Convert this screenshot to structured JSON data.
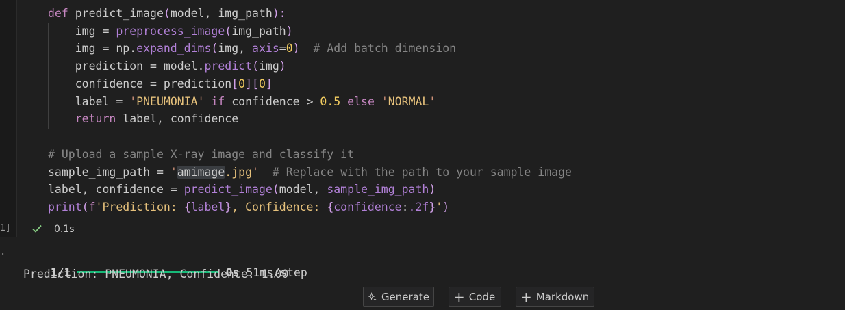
{
  "code_cell": {
    "lines": [
      {
        "parts": [
          [
            "kw",
            "def "
          ],
          [
            "var",
            "predict_image"
          ],
          [
            "brk",
            "("
          ],
          [
            "var",
            "model, img_path"
          ],
          [
            "brk",
            "):"
          ]
        ]
      },
      {
        "parts": [
          [
            "var",
            "    img = "
          ],
          [
            "fn",
            "preprocess_image"
          ],
          [
            "brk",
            "("
          ],
          [
            "var",
            "img_path"
          ],
          [
            "brk",
            ")"
          ]
        ]
      },
      {
        "parts": [
          [
            "var",
            "    img = np."
          ],
          [
            "fn",
            "expand_dims"
          ],
          [
            "brk",
            "("
          ],
          [
            "var",
            "img, "
          ],
          [
            "fn",
            "axis"
          ],
          [
            "var",
            "="
          ],
          [
            "num",
            "0"
          ],
          [
            "brk",
            ")"
          ],
          [
            "var",
            "  "
          ],
          [
            "cm",
            "# Add batch dimension"
          ]
        ]
      },
      {
        "parts": [
          [
            "var",
            "    prediction = model."
          ],
          [
            "fn",
            "predict"
          ],
          [
            "brk",
            "("
          ],
          [
            "var",
            "img"
          ],
          [
            "brk",
            ")"
          ]
        ]
      },
      {
        "parts": [
          [
            "var",
            "    confidence = prediction"
          ],
          [
            "brk",
            "["
          ],
          [
            "num",
            "0"
          ],
          [
            "brk",
            "]["
          ],
          [
            "num",
            "0"
          ],
          [
            "brk",
            "]"
          ]
        ]
      },
      {
        "parts": [
          [
            "var",
            "    label = "
          ],
          [
            "strq",
            "'"
          ],
          [
            "str",
            "PNEUMONIA"
          ],
          [
            "strq",
            "'"
          ],
          [
            "var",
            " "
          ],
          [
            "kw",
            "if"
          ],
          [
            "var",
            " confidence > "
          ],
          [
            "num",
            "0.5"
          ],
          [
            "var",
            " "
          ],
          [
            "kw",
            "else"
          ],
          [
            "var",
            " "
          ],
          [
            "strq",
            "'"
          ],
          [
            "str",
            "NORMAL"
          ],
          [
            "strq",
            "'"
          ]
        ]
      },
      {
        "parts": [
          [
            "var",
            "    "
          ],
          [
            "kw",
            "return"
          ],
          [
            "var",
            " label, confidence"
          ]
        ]
      },
      {
        "parts": [
          [
            "var",
            ""
          ]
        ]
      },
      {
        "parts": [
          [
            "cm",
            "# Upload a sample X-ray image and classify it"
          ]
        ]
      },
      {
        "parts": [
          [
            "var",
            "sample_img_path = "
          ],
          [
            "strq",
            "'"
          ],
          [
            "hl",
            "amimage"
          ],
          [
            "str",
            ".jpg"
          ],
          [
            "strq",
            "'"
          ],
          [
            "var",
            "  "
          ],
          [
            "cm",
            "# Replace with the path to your sample image"
          ]
        ]
      },
      {
        "parts": [
          [
            "var",
            "label, confidence = "
          ],
          [
            "fn",
            "predict_image"
          ],
          [
            "brk",
            "("
          ],
          [
            "var",
            "model, "
          ],
          [
            "fn",
            "sample_img_path"
          ],
          [
            "brk",
            ")"
          ]
        ]
      },
      {
        "parts": [
          [
            "fn",
            "print"
          ],
          [
            "brk",
            "("
          ],
          [
            "kw",
            "f"
          ],
          [
            "str",
            "'Prediction: "
          ],
          [
            "brk",
            "{"
          ],
          [
            "fn",
            "label"
          ],
          [
            "brk",
            "}"
          ],
          [
            "str",
            ", Confidence: "
          ],
          [
            "brk",
            "{"
          ],
          [
            "fn",
            "confidence"
          ],
          [
            "var",
            ":"
          ],
          [
            "fn",
            ".2f"
          ],
          [
            "brk",
            "}"
          ],
          [
            "str",
            "'"
          ],
          [
            "brk",
            ")"
          ]
        ]
      }
    ]
  },
  "execution": {
    "count_label": "1]",
    "time": "0.1s",
    "status_color": "#89d185"
  },
  "output": {
    "bullet": "·",
    "progress_prefix": "1/1",
    "progress_fraction": 1.0,
    "progress_suffix_bold": "0s",
    "progress_suffix": " 51ms/step",
    "result_line": "Prediction: PNEUMONIA, Confidence: 1.00",
    "progress_color": "#17b978"
  },
  "toolbar": {
    "generate_label": "Generate",
    "generate_icon": "sparkle-icon",
    "code_label": "Code",
    "code_icon": "plus-icon",
    "markdown_label": "Markdown",
    "markdown_icon": "plus-icon"
  }
}
